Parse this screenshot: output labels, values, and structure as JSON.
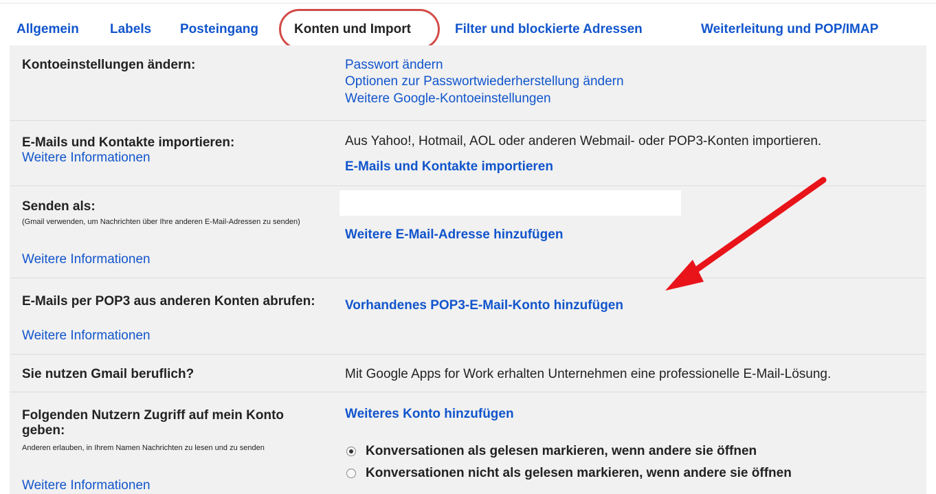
{
  "tabs": [
    {
      "label": "Allgemein",
      "active": false
    },
    {
      "label": "Labels",
      "active": false
    },
    {
      "label": "Posteingang",
      "active": false
    },
    {
      "label": "Konten und Import",
      "active": true
    },
    {
      "label": "Filter und blockierte Adressen",
      "active": false
    },
    {
      "label": "Weiterleitung und POP/IMAP",
      "active": false
    }
  ],
  "sections": {
    "account": {
      "label": "Kontoeinstellungen ändern:",
      "links": [
        "Passwort ändern",
        "Optionen zur Passwortwiederherstellung ändern",
        "Weitere Google-Kontoeinstellungen"
      ]
    },
    "import": {
      "label": "E-Mails und Kontakte importieren:",
      "more": "Weitere Informationen",
      "desc": "Aus Yahoo!, Hotmail, AOL oder anderen Webmail- oder POP3-Konten importieren.",
      "action": "E-Mails und Kontakte importieren"
    },
    "sendas": {
      "label": "Senden als:",
      "sub": "(Gmail verwenden, um Nachrichten über Ihre anderen E-Mail-Adressen zu senden)",
      "more": "Weitere Informationen",
      "action": "Weitere E-Mail-Adresse hinzufügen"
    },
    "pop3": {
      "label": "E-Mails per POP3 aus anderen Konten abrufen:",
      "more": "Weitere Informationen",
      "action": "Vorhandenes POP3-E-Mail-Konto hinzufügen"
    },
    "business": {
      "label": "Sie nutzen Gmail beruflich?",
      "desc": "Mit Google Apps for Work erhalten Unternehmen eine professionelle E-Mail-Lösung."
    },
    "access": {
      "label": "Folgenden Nutzern Zugriff auf mein Konto geben:",
      "sub": "Anderen erlauben, in Ihrem Namen Nachrichten zu lesen und zu senden",
      "more": "Weitere Informationen",
      "action": "Weiteres Konto hinzufügen",
      "options": [
        {
          "label": "Konversationen als gelesen markieren, wenn andere sie öffnen",
          "checked": true
        },
        {
          "label": "Konversationen nicht als gelesen markieren, wenn andere sie öffnen",
          "checked": false
        }
      ]
    }
  },
  "colors": {
    "link": "#1155cc",
    "highlight": "#d24b47",
    "arrow": "#e8141a",
    "panel": "#f1f1f1"
  }
}
